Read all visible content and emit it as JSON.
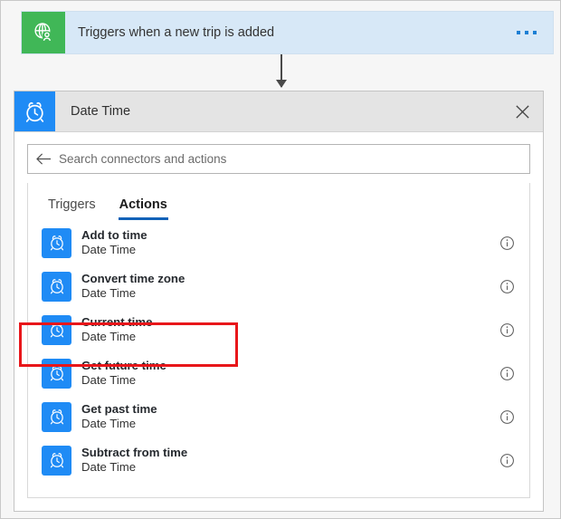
{
  "trigger_card": {
    "icon": "globe-person-icon",
    "icon_color": "#40b757",
    "background": "#d7e8f7",
    "title": "Triggers when a new trip is added",
    "menu": "ellipsis-menu"
  },
  "connector": {
    "icon": "down-arrow-icon",
    "color": "#4a4a4a"
  },
  "panel": {
    "header": {
      "icon": "alarm-clock-icon",
      "icon_color": "#1f8bf5",
      "title": "Date Time",
      "close": "close-icon"
    },
    "search": {
      "back_icon": "back-arrow-icon",
      "placeholder": "Search connectors and actions",
      "value": ""
    },
    "tabs": [
      {
        "label": "Triggers",
        "active": false
      },
      {
        "label": "Actions",
        "active": true
      }
    ],
    "tab_underline_color": "#1262b8",
    "actions": [
      {
        "title": "Add to time",
        "subtitle": "Date Time",
        "icon": "alarm-clock-icon",
        "info": "info-icon",
        "highlighted": false
      },
      {
        "title": "Convert time zone",
        "subtitle": "Date Time",
        "icon": "alarm-clock-icon",
        "info": "info-icon",
        "highlighted": false
      },
      {
        "title": "Current time",
        "subtitle": "Date Time",
        "icon": "alarm-clock-icon",
        "info": "info-icon",
        "highlighted": true
      },
      {
        "title": "Get future time",
        "subtitle": "Date Time",
        "icon": "alarm-clock-icon",
        "info": "info-icon",
        "highlighted": false
      },
      {
        "title": "Get past time",
        "subtitle": "Date Time",
        "icon": "alarm-clock-icon",
        "info": "info-icon",
        "highlighted": false
      },
      {
        "title": "Subtract from time",
        "subtitle": "Date Time",
        "icon": "alarm-clock-icon",
        "info": "info-icon",
        "highlighted": false
      }
    ]
  },
  "annotation": {
    "highlight_color": "#e8161a",
    "target": "Current time"
  }
}
